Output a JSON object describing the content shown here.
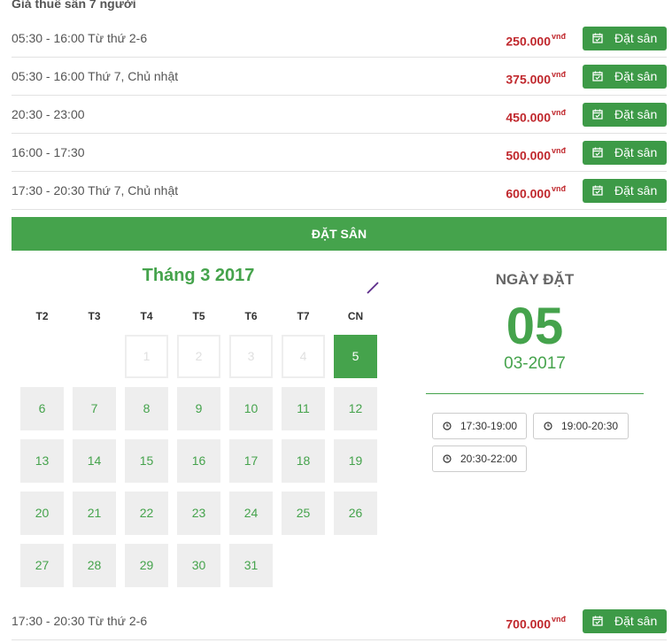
{
  "section_title": "Giá thuê sân 7 người",
  "currency_suffix": "vnđ",
  "book_label": "Đặt sân",
  "prices": [
    {
      "time": "05:30 - 16:00 Từ thứ 2-6",
      "price": "250.000"
    },
    {
      "time": "05:30 - 16:00 Thứ 7, Chủ nhật",
      "price": "375.000"
    },
    {
      "time": "20:30 - 23:00",
      "price": "450.000"
    },
    {
      "time": "16:00 - 17:30",
      "price": "500.000"
    },
    {
      "time": "17:30 - 20:30 Thứ 7, Chủ nhật",
      "price": "600.000"
    }
  ],
  "booking_bar_label": "ĐẶT SÂN",
  "calendar": {
    "month_title": "Tháng 3 2017",
    "weekdays": [
      "T2",
      "T3",
      "T4",
      "T5",
      "T6",
      "T7",
      "CN"
    ],
    "past_days": [
      "1",
      "2",
      "3",
      "4"
    ],
    "selected_day": "5",
    "days": [
      "6",
      "7",
      "8",
      "9",
      "10",
      "11",
      "12",
      "13",
      "14",
      "15",
      "16",
      "17",
      "18",
      "19",
      "20",
      "21",
      "22",
      "23",
      "24",
      "25",
      "26",
      "27",
      "28",
      "29",
      "30",
      "31"
    ]
  },
  "selected": {
    "label": "NGÀY ĐẶT",
    "day": "05",
    "month_year": "03-2017"
  },
  "time_slots": [
    "17:30-19:00",
    "19:00-20:30",
    "20:30-22:00"
  ],
  "last_price": {
    "time": "17:30 - 20:30 Từ thứ 2-6",
    "price": "700.000"
  },
  "colors": {
    "accent": "#45a34c",
    "price": "#c0282d",
    "button": "#3d9a47",
    "cell_bg": "#eeeeee"
  }
}
